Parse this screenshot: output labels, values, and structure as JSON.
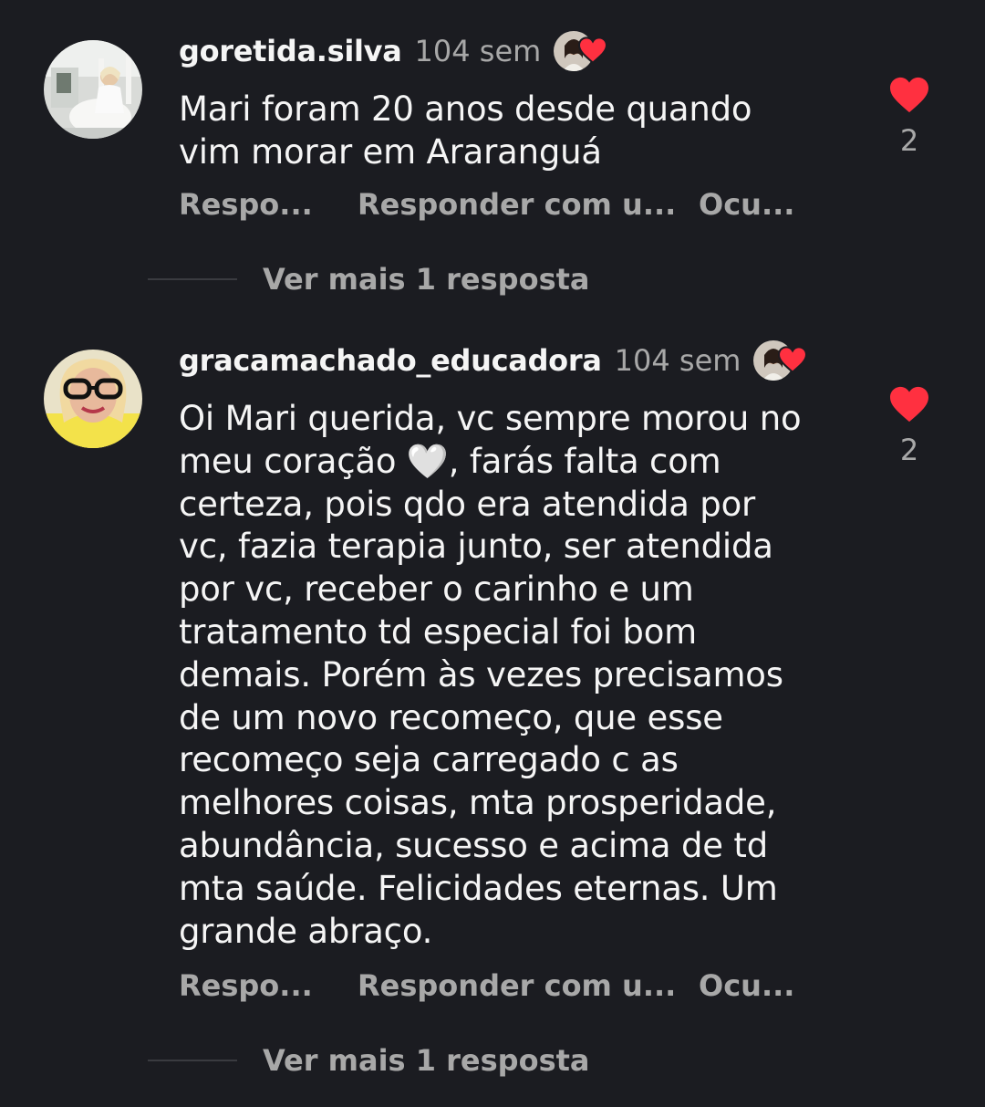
{
  "comments": [
    {
      "username": "goretida.silva",
      "time": "104 sem",
      "text": "Mari foram 20 anos desde quando\nvim morar em Araranguá",
      "likes": "2",
      "actions": {
        "reply": "Respo...",
        "reply_with": "Responder com u...",
        "hide": "Ocu..."
      },
      "more_replies": "Ver mais 1 resposta",
      "avatar_icon": "avatar-woman-white-dress",
      "liked_by_icon": "creator-liked-heart-icon"
    },
    {
      "username": "gracamachado_educadora",
      "time": "104 sem",
      "text_before_emoji": "Oi Mari querida, vc sempre morou no\nmeu coração ",
      "emoji": "🤍",
      "text_after_emoji": ", farás falta com\ncerteza, pois qdo era atendida por\nvc, fazia terapia junto, ser atendida\npor vc, receber o carinho e um\ntratamento td especial foi bom\ndemais. Porém às vezes precisamos\nde um novo recomeço, que esse\nrecomeço seja carregado c as\nmelhores coisas, mta prosperidade,\nabundância, sucesso e acima de td\nmta saúde. Felicidades eternas. Um\ngrande abraço.",
      "likes": "2",
      "actions": {
        "reply": "Respo...",
        "reply_with": "Responder com u...",
        "hide": "Ocu..."
      },
      "more_replies": "Ver mais 1 resposta",
      "avatar_icon": "avatar-woman-glasses",
      "liked_by_icon": "creator-liked-heart-icon"
    }
  ],
  "colors": {
    "background": "#1b1c21",
    "text": "#f5f5f5",
    "secondary": "#a8a8a8",
    "heart": "#ff3040"
  }
}
